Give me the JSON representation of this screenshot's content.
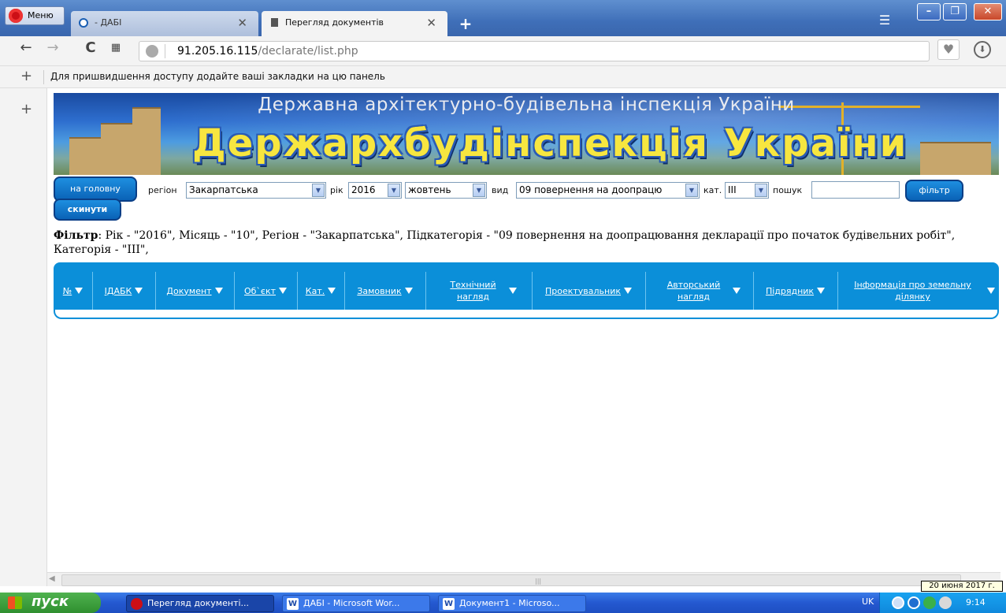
{
  "browser": {
    "menu_label": "Меню",
    "tabs": [
      {
        "title": "- ДАБІ"
      },
      {
        "title": "Перегляд документів"
      }
    ],
    "new_tab": "+",
    "address": {
      "host": "91.205.16.115",
      "path": "/declarate/list.php"
    },
    "bookmarks_hint": "Для пришвидшення доступу додайте ваші закладки на цю панель"
  },
  "banner": {
    "subtitle": "Державна архітектурно-будівельна інспекція України",
    "title": "Держархбудінспекція України"
  },
  "filters": {
    "home_button": "на головну",
    "reset_button": "скинути",
    "filter_button": "фільтр",
    "region_label": "регіон",
    "region_value": "Закарпатська",
    "year_label": "рік",
    "year_value": "2016",
    "month_value": "жовтень",
    "type_label": "вид",
    "type_value": "09 повернення на доопрацю",
    "cat_label": "кат.",
    "cat_value": "III",
    "search_label": "пошук",
    "search_value": ""
  },
  "filter_summary": {
    "label": "Фільтр",
    "text": ": Рік - \"2016\", Місяць - \"10\", Регіон - \"Закарпатська\", Підкатегорія - \"09 повернення на доопрацювання декларації про початок будівельних робіт\", Категорія - \"ІІІ\","
  },
  "table": {
    "columns": [
      "№",
      "ІДАБК",
      "Документ",
      "Об`єкт",
      "Кат.",
      "Замовник",
      "Технічний нагляд",
      "Проектувальник",
      "Авторський нагляд",
      "Підрядник",
      "Інформація про земельну ділянку"
    ],
    "rows": []
  },
  "status": {
    "date_tooltip": "20 июня 2017 г."
  },
  "taskbar": {
    "start_label": "пуск",
    "tasks": [
      "Перегляд документі...",
      "ДАБІ - Microsoft Wor...",
      "Документ1 - Microso..."
    ],
    "lang": "UK",
    "clock": "9:14"
  },
  "colors": {
    "table_header": "#0b8fd9",
    "button_blue": "#0a62b6",
    "banner_title": "#f7e640"
  }
}
